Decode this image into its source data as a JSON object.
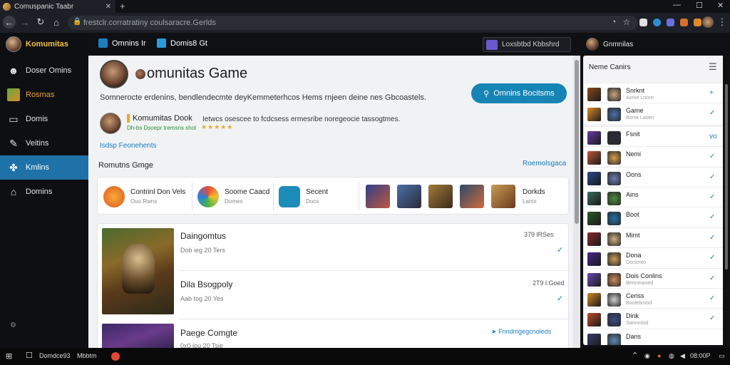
{
  "browser": {
    "tab_title": "Comuspanic Taabr",
    "url": "frestclr.corratratiny coulsaracre.Gerlds",
    "tab_close": "✕",
    "new_tab": "+"
  },
  "sidebar": {
    "brand": "Komumitas",
    "items": [
      {
        "label": "Doser Omins",
        "icon": "discord-icon"
      },
      {
        "label": "Rosmas",
        "icon": "game-icon"
      },
      {
        "label": "Domis",
        "icon": "folder-icon"
      },
      {
        "label": "Veitins",
        "icon": "pencil-icon"
      },
      {
        "label": "Kmlins",
        "icon": "puzzle-icon"
      },
      {
        "label": "Domins",
        "icon": "home-icon"
      }
    ]
  },
  "topnav": {
    "tab1": "Omnins Ir",
    "tab2": "Domis8 Gt",
    "button": "Loxsbtbd Kbbshrd"
  },
  "hero": {
    "title": "omunitas Game",
    "description": "Somnerocte erdenins, bendlendecmte deyKemmeterhcos Hems rnjeen deine nes Gbcoastels.",
    "cta": "Omnins Bocitsms"
  },
  "author": {
    "name": "Komumitas Dook",
    "subtitle": "Dh-bs Dsoepr tremsns shol",
    "stars": "★★★★★",
    "description": "Ietwcs osescee to fcdcsess ermesribe noregeocie tassogtmes."
  },
  "links": {
    "follow": "Isdsp Feonehents",
    "section_title": "Romutns Gmge",
    "section_link": "Roemolsgaca"
  },
  "cards": [
    {
      "title": "Contrinl Don Vels",
      "sub": "Ouo Rwns"
    },
    {
      "title": "Soome Caacd",
      "sub": "Domes"
    },
    {
      "title": "Secent",
      "sub": "Docs"
    },
    {
      "title": "Dorkds",
      "sub": "Lams"
    }
  ],
  "games": [
    {
      "title": "Daingomtus",
      "sub": "Dob ieg 20 Ters",
      "right": "379 lRSes"
    },
    {
      "title": "Dila Bsogpoly",
      "sub": "Aab tog 20 Yes",
      "right": "2T9 l:Goed"
    },
    {
      "title": "Paege Comgte",
      "sub": "0x0 iou 20 Tsie",
      "right": "Fnndmgegcnoleds"
    }
  ],
  "rpanel": {
    "header": "Gnmnilas",
    "title": "Neme Canirs",
    "rows": [
      {
        "name": "Snrknt",
        "sub": "Aome Loonn",
        "check": "+"
      },
      {
        "name": "Game",
        "sub": "Bomk Laoen",
        "check": "✓"
      },
      {
        "name": "Fsnit",
        "sub": "",
        "check": "vo"
      },
      {
        "name": "Nemi",
        "sub": "",
        "check": "✓"
      },
      {
        "name": "Oons",
        "sub": "",
        "check": "✓"
      },
      {
        "name": "Ains",
        "sub": "",
        "check": "✓"
      },
      {
        "name": "Boot",
        "sub": "",
        "check": "✓"
      },
      {
        "name": "Mimt",
        "sub": "",
        "check": "✓"
      },
      {
        "name": "Dona",
        "sub": "Dorsimto",
        "check": "✓"
      },
      {
        "name": "Dois Conlins",
        "sub": "Bertnmaoed",
        "check": "✓"
      },
      {
        "name": "Ceriss",
        "sub": "Bootebrood",
        "check": "✓"
      },
      {
        "name": "Dink",
        "sub": "Samnolod",
        "check": "✓"
      },
      {
        "name": "Dans",
        "sub": "",
        "check": ""
      }
    ]
  },
  "taskbar": {
    "item1": "Domdce93",
    "item2": "Mbbtm",
    "clock": "08:00P"
  }
}
